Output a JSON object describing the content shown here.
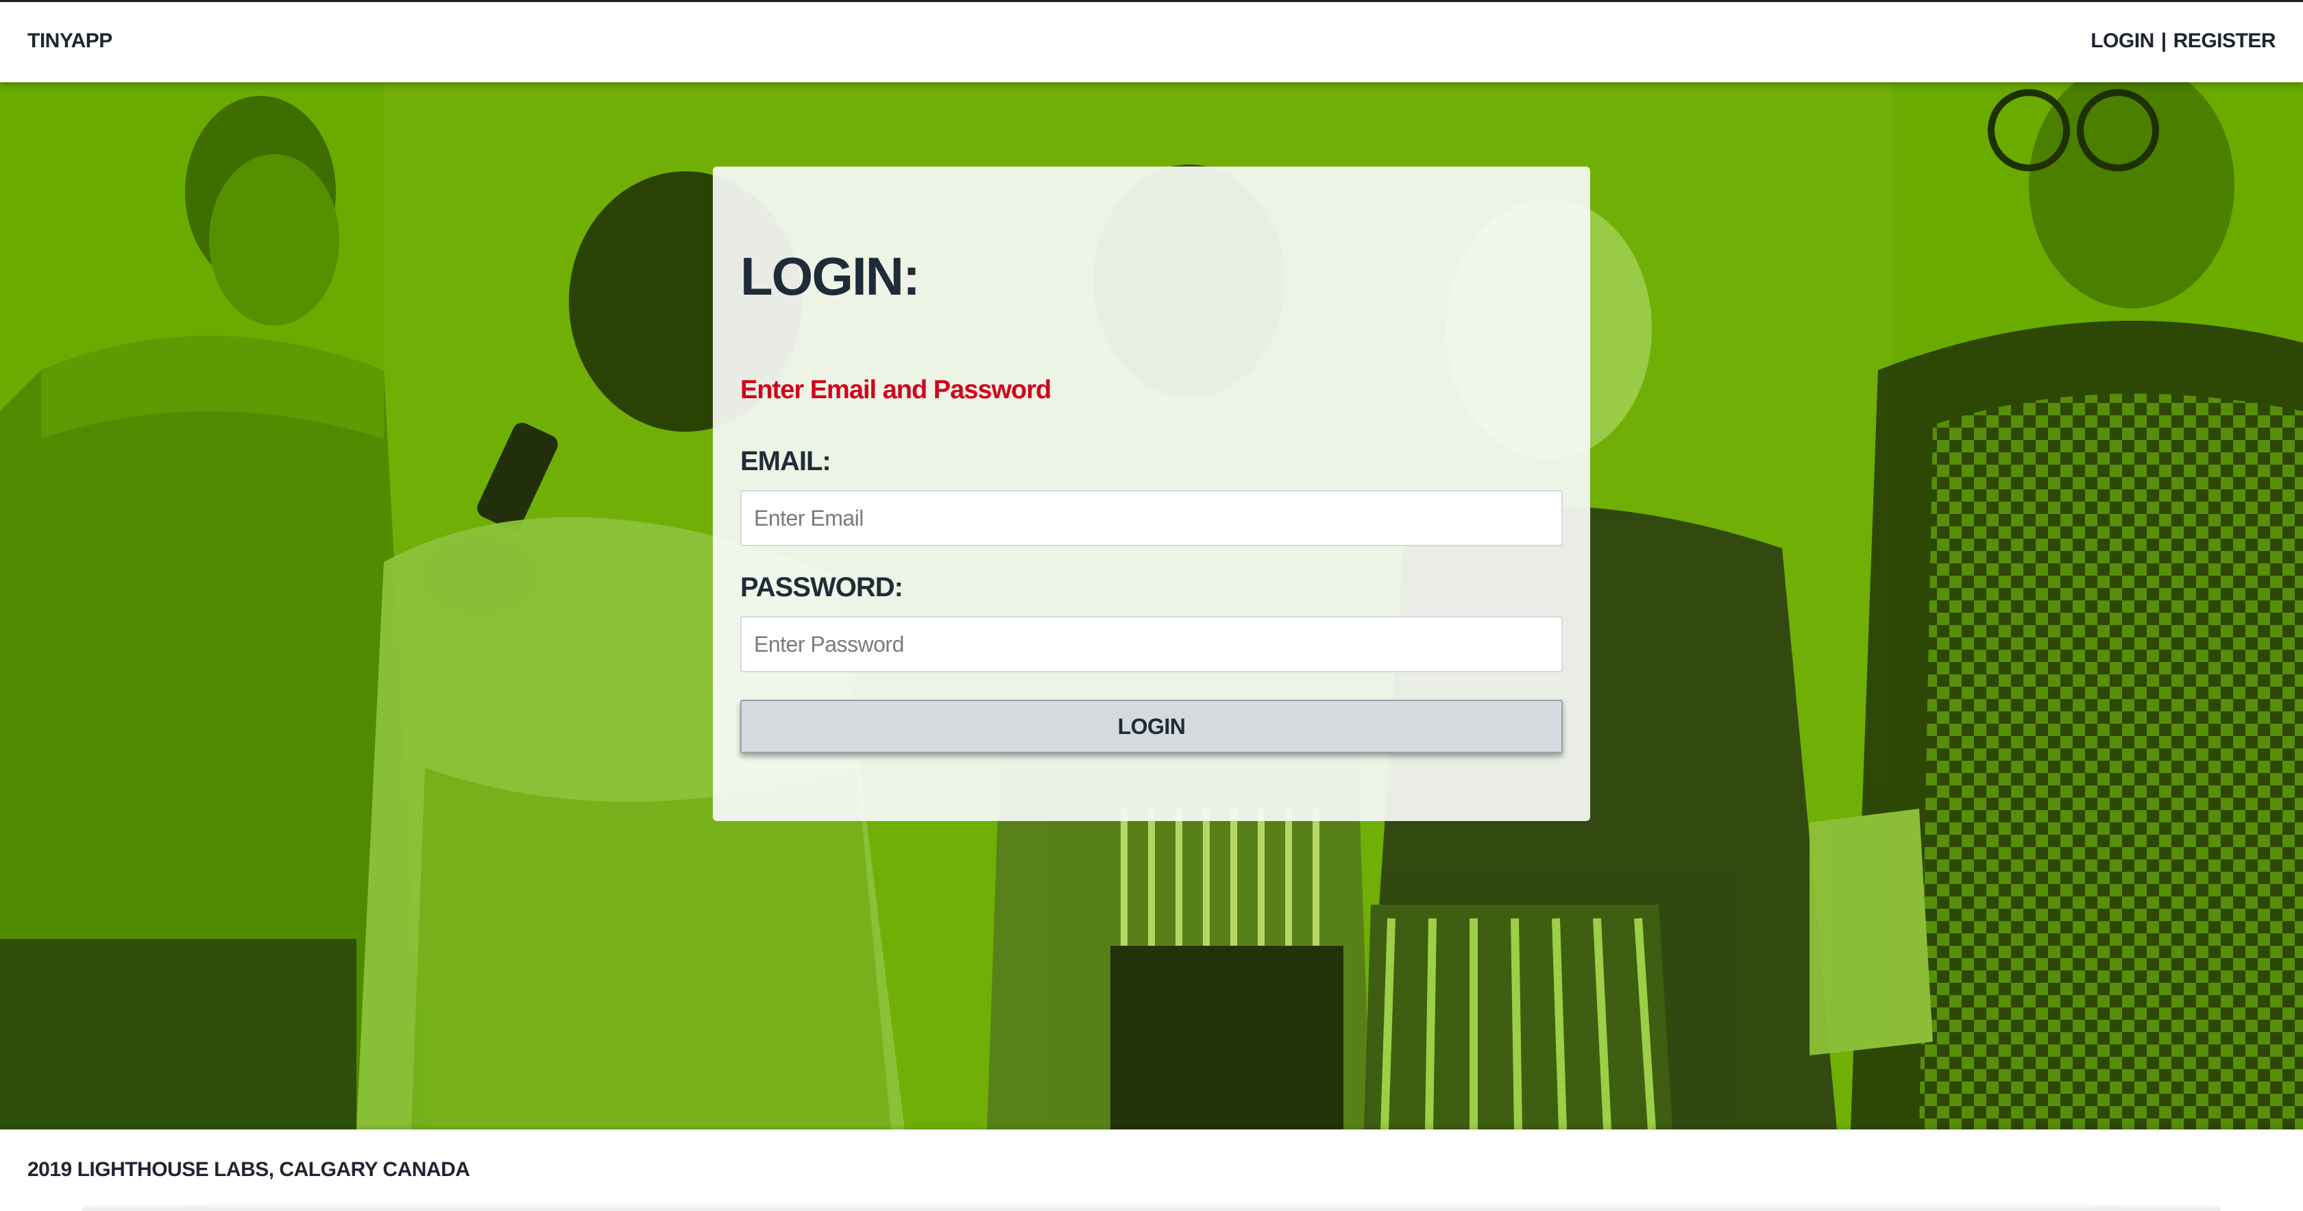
{
  "app": {
    "brand": "TINYAPP"
  },
  "nav": {
    "login": "LOGIN",
    "separator": "|",
    "register": "REGISTER"
  },
  "login_form": {
    "title": "LOGIN:",
    "error_message": "Enter Email and Password",
    "email_label": "EMAIL:",
    "email_placeholder": "Enter Email",
    "email_value": "",
    "password_label": "PASSWORD:",
    "password_placeholder": "Enter Password",
    "password_value": "",
    "submit_label": "LOGIN"
  },
  "footer": {
    "text": "2019 LIGHTHOUSE LABS, CALGARY CANADA"
  },
  "colors": {
    "hero_overlay": "#6aab00",
    "error": "#d0021b",
    "text_dark": "#1f2c38"
  },
  "icons": {
    "hero_image": "people-with-phones-photo"
  }
}
